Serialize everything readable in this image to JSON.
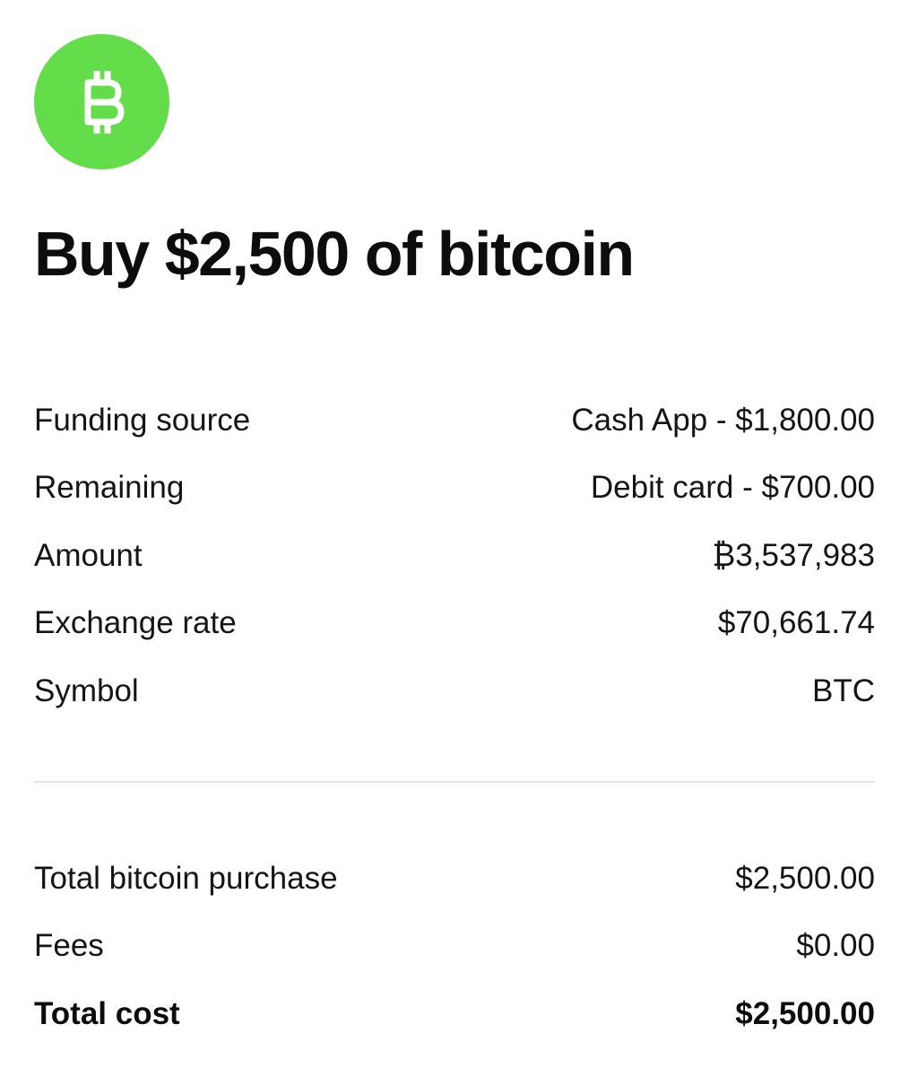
{
  "header": {
    "icon": "bitcoin-icon",
    "icon_color": "#63dd49",
    "title": "Buy $2,500 of bitcoin"
  },
  "details": [
    {
      "label": "Funding source",
      "value": "Cash App - $1,800.00"
    },
    {
      "label": "Remaining",
      "value": "Debit card - $700.00"
    },
    {
      "label": "Amount",
      "value": "₿3,537,983"
    },
    {
      "label": "Exchange rate",
      "value": "$70,661.74"
    },
    {
      "label": "Symbol",
      "value": "BTC"
    }
  ],
  "totals": [
    {
      "label": "Total bitcoin purchase",
      "value": "$2,500.00"
    },
    {
      "label": "Fees",
      "value": "$0.00"
    },
    {
      "label": "Total cost",
      "value": "$2,500.00"
    }
  ]
}
